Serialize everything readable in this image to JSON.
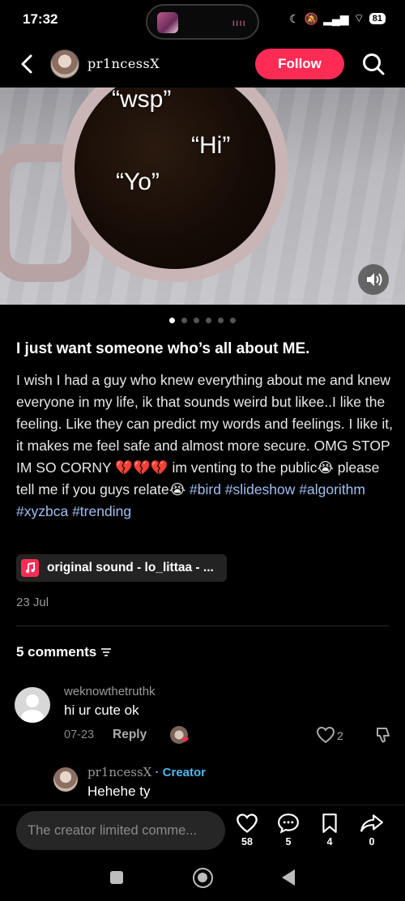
{
  "status_bar": {
    "time": "17:32",
    "battery": "81"
  },
  "header": {
    "username": "pr1ncessX",
    "follow_label": "Follow"
  },
  "media": {
    "overlay_texts": [
      "“wsp”",
      "“Hi”",
      "“Yo”"
    ],
    "slides_total": 6,
    "active_slide": 1
  },
  "caption": {
    "title": "I just want someone who’s all about ME.",
    "body_main": "I wish I had a guy who knew everything about me and knew everyone in my life, ik that sounds weird but likee..I like the feeling. Like they can predict my words and feelings. I like it, it makes me feel safe and almost more secure. OMG STOP IM SO CORNY ",
    "emoji_broken_hearts": "💔💔💔",
    "body_venting": " im venting to the public",
    "emoji_cry_1": "😭",
    "body_relate": " please tell me if you guys relate",
    "emoji_cry_2": "😭",
    "hashtags": [
      "#bird",
      "#slideshow",
      "#algorithm",
      "#xyzbca",
      "#trending"
    ]
  },
  "sound": {
    "label": "original sound - lo_littaa - ..."
  },
  "post_date": "23 Jul",
  "comments_section": {
    "header": "5 comments",
    "comments": [
      {
        "username": "weknowthetruthk",
        "text": "hi ur cute ok",
        "date": "07-23",
        "reply_label": "Reply",
        "likes": "2"
      }
    ],
    "replies": [
      {
        "username": "pr1ncessX",
        "badge": " · Creator",
        "text": "Hehehe ty"
      }
    ]
  },
  "bottom_bar": {
    "input_placeholder": "The creator limited comme...",
    "likes": "58",
    "comments": "5",
    "saves": "4",
    "shares": "0"
  },
  "colors": {
    "accent": "#fe2c55",
    "hashtag": "#9fbff5",
    "creator_badge": "#4fb8f0"
  }
}
